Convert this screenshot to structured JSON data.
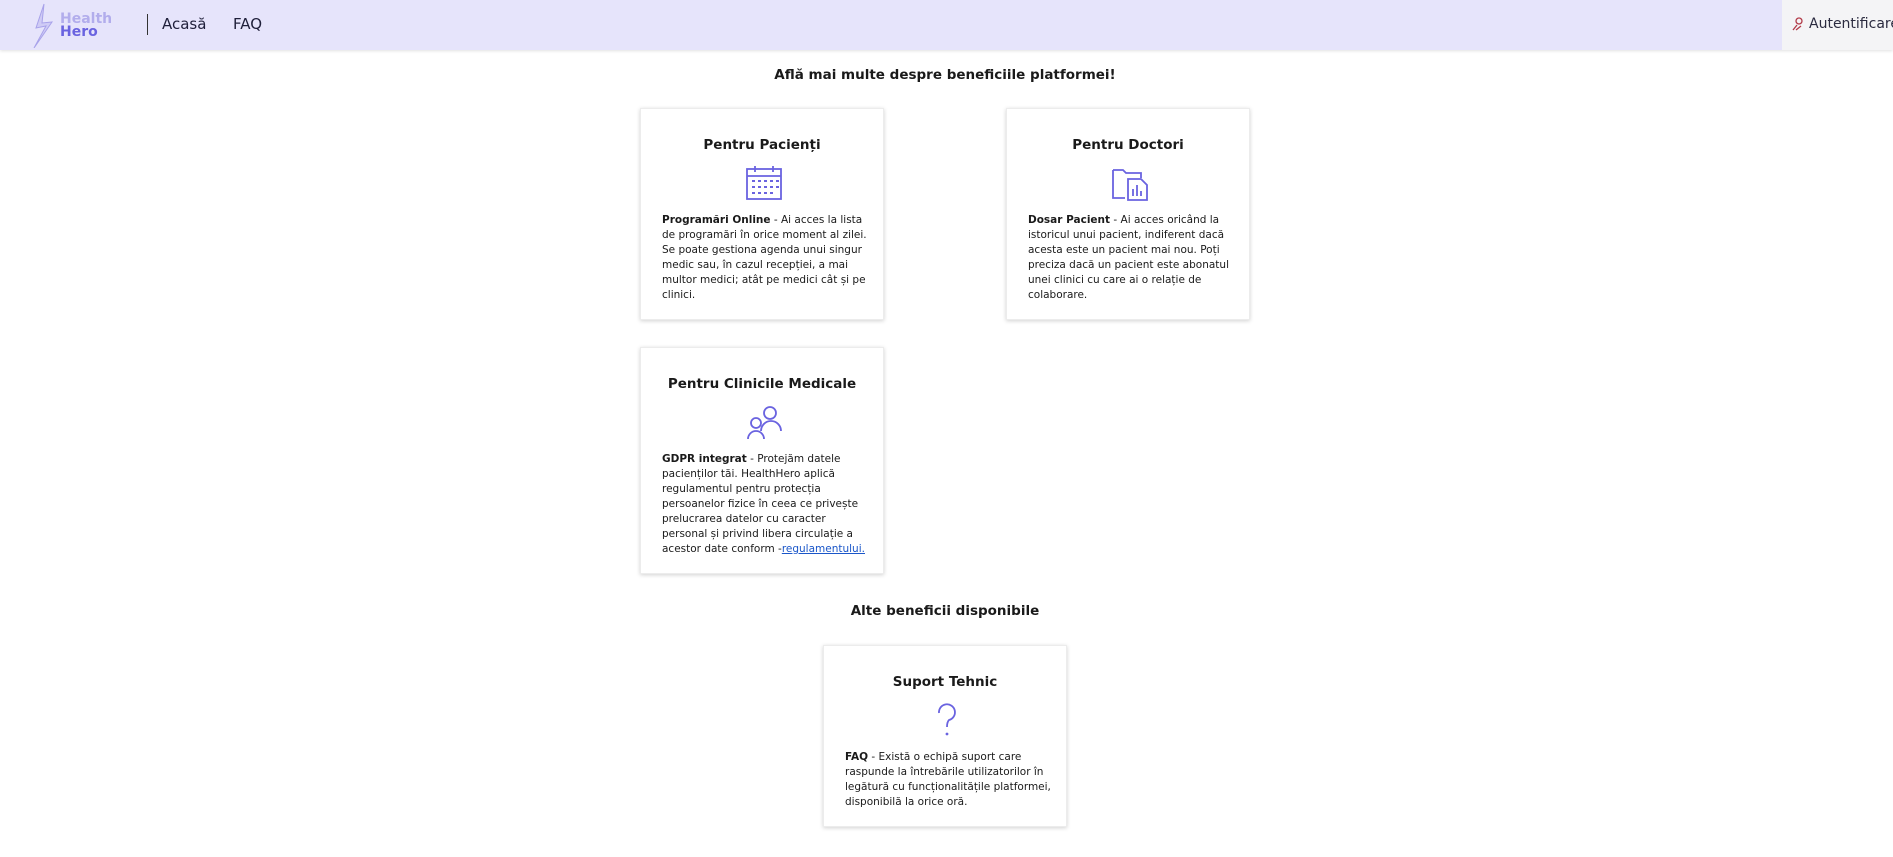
{
  "nav": {
    "logo_line1": "Health",
    "logo_line2": "Hero",
    "home": "Acasă",
    "faq": "FAQ",
    "login": "Autentificare"
  },
  "main": {
    "section1_title": "Află mai multe despre beneficiile platformei!",
    "section2_title": "Alte beneficii disponibile"
  },
  "cards": {
    "patients": {
      "title": "Pentru Pacienți",
      "icon": "calendar-icon",
      "lead": "Programări Online",
      "text": " - Ai acces la lista de programări în orice moment al zilei. Se poate gestiona agenda unui singur medic sau, în cazul recepției, a mai multor medici; atât pe medici cât și pe clinici."
    },
    "doctors": {
      "title": "Pentru Doctori",
      "icon": "patient-file-icon",
      "lead": "Dosar Pacient",
      "text": " - Ai acces oricând la istoricul unui pacient, indiferent dacă acesta este un pacient mai nou. Poți preciza dacă un pacient este abonatul unei clinici cu care ai o relație de colaborare."
    },
    "clinics": {
      "title": "Pentru Clinicile Medicale",
      "icon": "people-icon",
      "lead": "GDPR integrat",
      "text": " - Protejăm datele pacienților tăi. HealthHero aplică regulamentul pentru protecția persoanelor fizice în ceea ce privește prelucrarea datelor cu caracter personal și privind libera circulație a acestor date conform -",
      "link": "regulamentului."
    },
    "support": {
      "title": "Suport Tehnic",
      "icon": "question-icon",
      "lead": "FAQ",
      "text": " - Există o echipă suport care raspunde la întrebările utilizatorilor în legătură cu funcționalitățile platformei, disponibilă la orice oră."
    }
  },
  "colors": {
    "navbar": "#e6e4fb",
    "accent": "#6a63e0",
    "link": "#1a56c9"
  }
}
